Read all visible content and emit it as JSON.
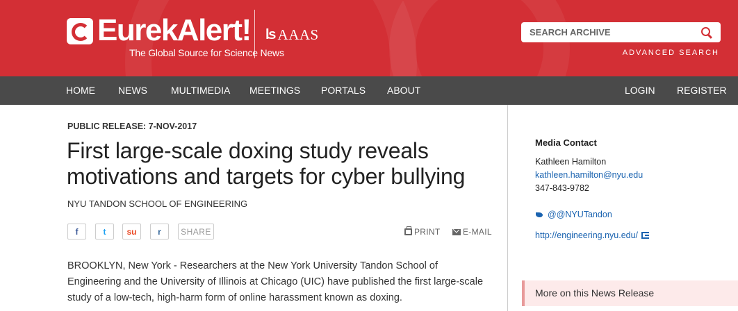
{
  "header": {
    "logo_title": "EurekAlert!",
    "logo_tagline": "The Global Source for Science News",
    "partner_logo": "AAAS",
    "search": {
      "placeholder": "SEARCH ARCHIVE",
      "icon": "search-icon"
    },
    "advanced_search": "ADVANCED SEARCH",
    "brand_color": "#d32f35"
  },
  "nav": {
    "items": [
      "HOME",
      "NEWS",
      "MULTIMEDIA",
      "MEETINGS",
      "PORTALS",
      "ABOUT"
    ],
    "login": "LOGIN",
    "register": "REGISTER"
  },
  "article": {
    "release_date": "PUBLIC RELEASE: 7-NOV-2017",
    "title": "First large-scale doxing study reveals motivations and targets for cyber bullying",
    "source": "NYU TANDON SCHOOL OF ENGINEERING",
    "share": {
      "facebook": "f",
      "twitter": "t",
      "stumbleupon": "su",
      "reddit": "r",
      "label": "SHARE"
    },
    "print": "PRINT",
    "email": "E-MAIL",
    "body": "BROOKLYN, New York - Researchers at the New York University Tandon School of Engineering and the University of Illinois at Chicago (UIC) have published the first large-scale study of a low-tech, high-harm form of online harassment known as doxing."
  },
  "sidebar": {
    "media_contact_title": "Media Contact",
    "contact_name": "Kathleen Hamilton",
    "contact_email": "kathleen.hamilton@nyu.edu",
    "contact_phone": "347-843-9782",
    "twitter": "@@NYUTandon",
    "website": "http://engineering.nyu.edu/",
    "more_title": "More on this News Release"
  }
}
